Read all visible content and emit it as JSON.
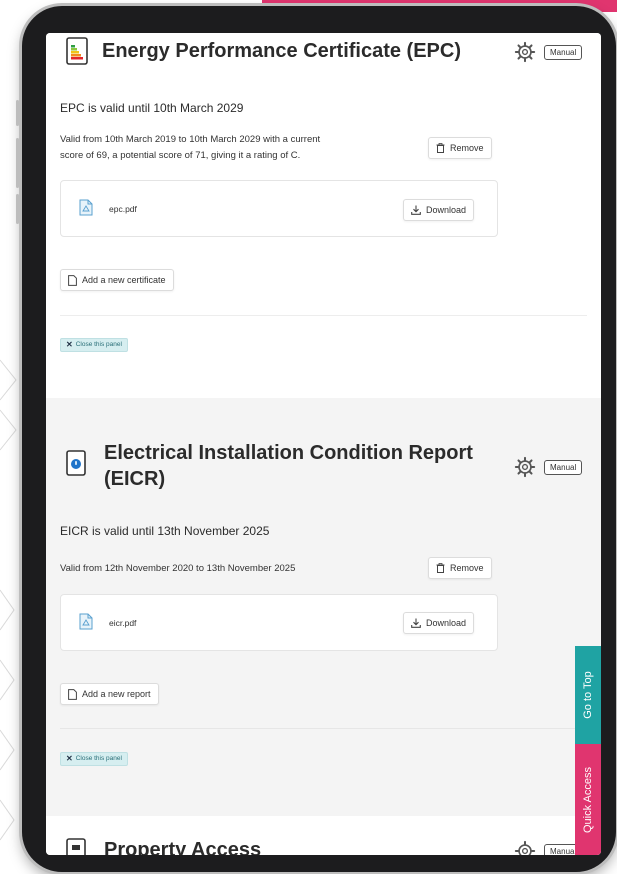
{
  "epc": {
    "title": "Energy Performance Certificate (EPC)",
    "manual_label": "Manual",
    "valid_until": "EPC is valid until 10th March 2029",
    "detail_line1": "Valid from 10th March 2019 to 10th March 2029 with a current",
    "detail_line2": "score of 69, a potential score of 71, giving it a rating of C.",
    "remove_label": "Remove",
    "file_name": "epc.pdf",
    "download_label": "Download",
    "add_label": "Add a new certificate",
    "close_label": "Close this panel"
  },
  "eicr": {
    "title_line1": "Electrical Installation Condition Report",
    "title_line2": "(EICR)",
    "manual_label": "Manual",
    "valid_until": "EICR is valid until 13th November 2025",
    "detail": "Valid from 12th November 2020 to 13th November 2025",
    "remove_label": "Remove",
    "file_name": "eicr.pdf",
    "download_label": "Download",
    "add_label": "Add a new report",
    "close_label": "Close this panel"
  },
  "property_access": {
    "title": "Property Access",
    "manual_label": "Manual"
  },
  "side_tabs": {
    "go_to_top": "Go to Top",
    "quick_access": "Quick Access"
  },
  "colors": {
    "brand_pink": "#e0356f",
    "teal": "#1fa3a3",
    "close_chip_bg": "#d6eef0"
  },
  "icons": [
    "epc-rating-icon",
    "gear-icon",
    "trash-icon",
    "pdf-file-icon",
    "download-icon",
    "document-icon",
    "close-icon",
    "eicr-icon",
    "property-access-icon"
  ]
}
